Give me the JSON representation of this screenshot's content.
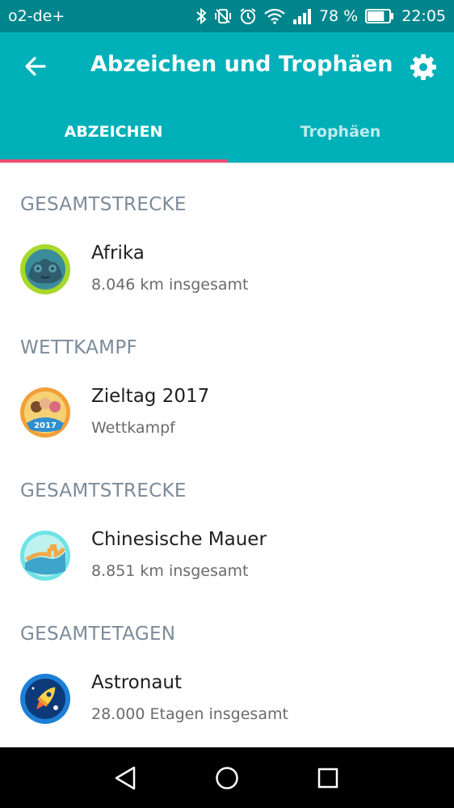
{
  "status_bar": {
    "carrier": "o2-de+",
    "battery_percent": "78 %",
    "battery_level": 0.78,
    "time": "22:05",
    "icons": [
      "bluetooth-icon",
      "vibrate-icon",
      "alarm-icon",
      "wifi-icon",
      "signal-icon",
      "battery-icon"
    ]
  },
  "app_bar": {
    "title": "Abzeichen und Trophäen",
    "back_icon": "arrow-left-icon",
    "settings_icon": "gear-icon"
  },
  "tabs": [
    {
      "label": "ABZEICHEN",
      "active": true
    },
    {
      "label": "Trophäen",
      "active": false
    }
  ],
  "colors": {
    "status_bar": "#01858c",
    "primary": "#00b0b9",
    "tab_indicator": "#ef4b72",
    "section_title": "#7c8b99"
  },
  "sections": [
    {
      "title": "GESAMTSTRECKE",
      "item": {
        "name": "Afrika",
        "detail": "8.046 km insgesamt",
        "badge": "gorilla-badge-icon"
      }
    },
    {
      "title": "WETTKAMPF",
      "item": {
        "name": "Zieltag 2017",
        "detail": "Wettkampf",
        "badge": "2017",
        "badge_icon": "zieltag-2017-badge-icon"
      }
    },
    {
      "title": "GESAMTSTRECKE",
      "item": {
        "name": "Chinesische Mauer",
        "detail": "8.851 km insgesamt",
        "badge": "great-wall-badge-icon"
      }
    },
    {
      "title": "GESAMTETAGEN",
      "item": {
        "name": "Astronaut",
        "detail": "28.000 Etagen insgesamt",
        "badge": "rocket-badge-icon"
      }
    }
  ],
  "nav_bar": {
    "back": "triangle-back-icon",
    "home": "circle-home-icon",
    "recents": "square-recents-icon"
  }
}
